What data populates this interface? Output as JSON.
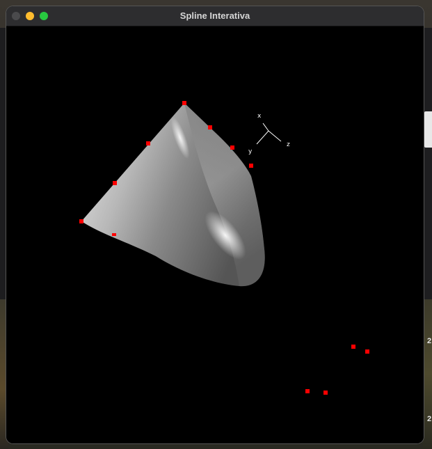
{
  "window": {
    "title": "Spline Interativa"
  },
  "axes": {
    "x_label": "x",
    "y_label": "y",
    "z_label": "z"
  },
  "background_numbers": [
    "2",
    "2"
  ],
  "colors": {
    "canvas_bg": "#000000",
    "control_point": "#ff0000",
    "surface": "#c8c8c8",
    "titlebar": "#2d2d2f"
  },
  "icons": [
    "close-icon",
    "minimize-icon",
    "maximize-icon"
  ]
}
